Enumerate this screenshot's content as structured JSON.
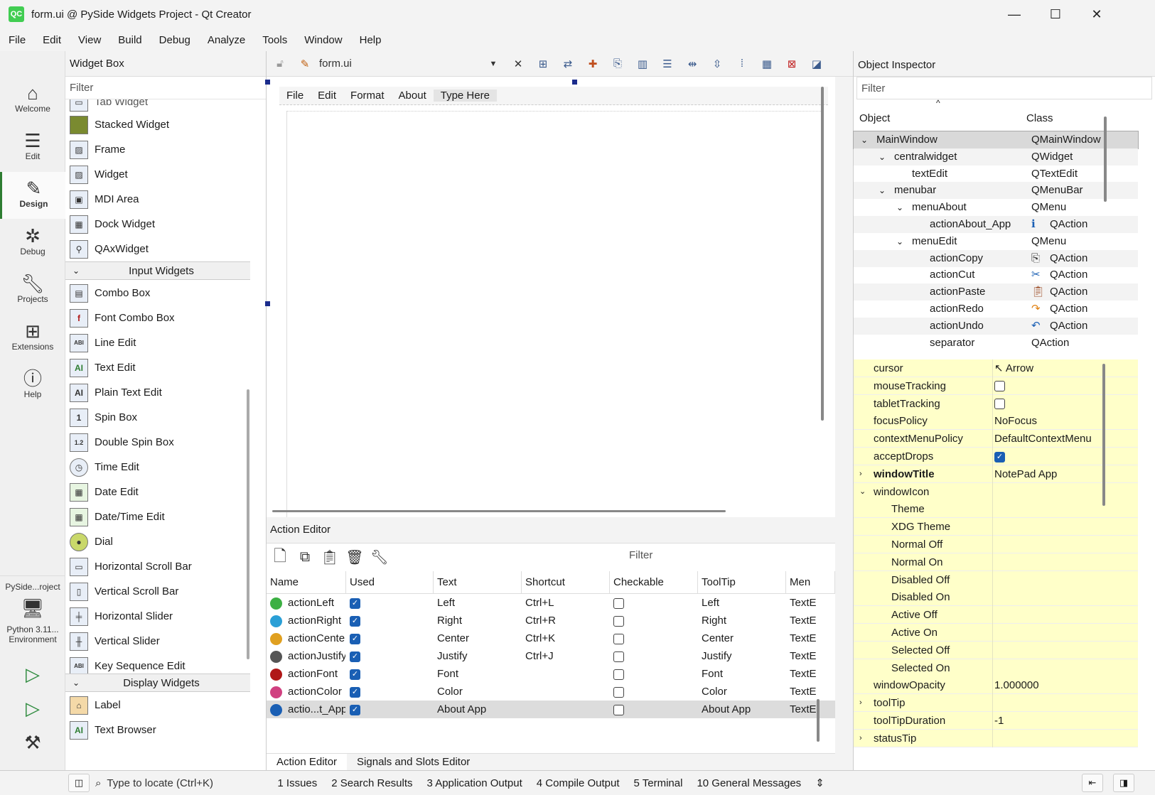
{
  "window": {
    "title": "form.ui @ PySide Widgets Project - Qt Creator",
    "icon_text": "QC"
  },
  "menubar": [
    "File",
    "Edit",
    "View",
    "Build",
    "Debug",
    "Analyze",
    "Tools",
    "Window",
    "Help"
  ],
  "modes": [
    {
      "label": "Welcome",
      "icon": "home-icon"
    },
    {
      "label": "Edit",
      "icon": "edit-icon"
    },
    {
      "label": "Design",
      "icon": "design-icon"
    },
    {
      "label": "Debug",
      "icon": "debug-icon"
    },
    {
      "label": "Projects",
      "icon": "wrench-icon"
    },
    {
      "label": "Extensions",
      "icon": "extensions-icon"
    },
    {
      "label": "Help",
      "icon": "help-icon"
    }
  ],
  "project_selector": {
    "project": "PySide...roject",
    "kit_line1": "Python 3.11...",
    "kit_line2": "Environment"
  },
  "widget_box": {
    "title": "Widget Box",
    "filter_placeholder": "Filter",
    "partial_item": "Tab Widget",
    "containers": [
      "Stacked Widget",
      "Frame",
      "Widget",
      "MDI Area",
      "Dock Widget",
      "QAxWidget"
    ],
    "input_category": "Input Widgets",
    "inputs": [
      "Combo Box",
      "Font Combo Box",
      "Line Edit",
      "Text Edit",
      "Plain Text Edit",
      "Spin Box",
      "Double Spin Box",
      "Time Edit",
      "Date Edit",
      "Date/Time Edit",
      "Dial",
      "Horizontal Scroll Bar",
      "Vertical Scroll Bar",
      "Horizontal Slider",
      "Vertical Slider",
      "Key Sequence Edit"
    ],
    "display_category": "Display Widgets",
    "displays": [
      "Label",
      "Text Browser"
    ]
  },
  "editor": {
    "file": "form.ui",
    "form_menu": [
      "File",
      "Edit",
      "Format",
      "About",
      "Type Here"
    ]
  },
  "action_editor": {
    "title": "Action Editor",
    "filter_placeholder": "Filter",
    "columns": [
      "Name",
      "Used",
      "Text",
      "Shortcut",
      "Checkable",
      "ToolTip",
      "Men"
    ],
    "rows": [
      {
        "name": "actionLeft",
        "used": true,
        "text": "Left",
        "shortcut": "Ctrl+L",
        "checkable": false,
        "tooltip": "Left",
        "menu": "TextE",
        "color": "#3cb043"
      },
      {
        "name": "actionRight",
        "used": true,
        "text": "Right",
        "shortcut": "Ctrl+R",
        "checkable": false,
        "tooltip": "Right",
        "menu": "TextE",
        "color": "#2a9fd6"
      },
      {
        "name": "actionCenter",
        "used": true,
        "text": "Center",
        "shortcut": "Ctrl+K",
        "checkable": false,
        "tooltip": "Center",
        "menu": "TextE",
        "color": "#e0a020"
      },
      {
        "name": "actionJustify",
        "used": true,
        "text": "Justify",
        "shortcut": "Ctrl+J",
        "checkable": false,
        "tooltip": "Justify",
        "menu": "TextE",
        "color": "#555555"
      },
      {
        "name": "actionFont",
        "used": true,
        "text": "Font",
        "shortcut": "",
        "checkable": false,
        "tooltip": "Font",
        "menu": "TextE",
        "color": "#b01818"
      },
      {
        "name": "actionColor",
        "used": true,
        "text": "Color",
        "shortcut": "",
        "checkable": false,
        "tooltip": "Color",
        "menu": "TextE",
        "color": "#d04080"
      },
      {
        "name": "actio...t_App",
        "used": true,
        "text": "About App",
        "shortcut": "",
        "checkable": false,
        "tooltip": "About App",
        "menu": "TextE",
        "color": "#1a5fb4"
      }
    ],
    "tabs": [
      "Action Editor",
      "Signals and Slots Editor"
    ]
  },
  "object_inspector": {
    "title": "Object Inspector",
    "filter_placeholder": "Filter",
    "columns": [
      "Object",
      "Class"
    ],
    "rows": [
      {
        "object": "MainWindow",
        "class": "QMainWindow",
        "depth": 0,
        "expanded": true
      },
      {
        "object": "centralwidget",
        "class": "QWidget",
        "depth": 1,
        "expanded": true
      },
      {
        "object": "textEdit",
        "class": "QTextEdit",
        "depth": 2
      },
      {
        "object": "menubar",
        "class": "QMenuBar",
        "depth": 1,
        "expanded": true
      },
      {
        "object": "menuAbout",
        "class": "QMenu",
        "depth": 2,
        "expanded": true
      },
      {
        "object": "actionAbout_App",
        "class": "QAction",
        "depth": 3,
        "icon": "info-icon"
      },
      {
        "object": "menuEdit",
        "class": "QMenu",
        "depth": 2,
        "expanded": true
      },
      {
        "object": "actionCopy",
        "class": "QAction",
        "depth": 3,
        "icon": "copy-icon"
      },
      {
        "object": "actionCut",
        "class": "QAction",
        "depth": 3,
        "icon": "cut-icon"
      },
      {
        "object": "actionPaste",
        "class": "QAction",
        "depth": 3,
        "icon": "paste-icon"
      },
      {
        "object": "actionRedo",
        "class": "QAction",
        "depth": 3,
        "icon": "redo-icon"
      },
      {
        "object": "actionUndo",
        "class": "QAction",
        "depth": 3,
        "icon": "undo-icon"
      },
      {
        "object": "separator",
        "class": "QAction",
        "depth": 3
      }
    ]
  },
  "property_editor": {
    "rows": [
      {
        "name": "cursor",
        "value": "Arrow",
        "kind": "text"
      },
      {
        "name": "mouseTracking",
        "value": false,
        "kind": "check"
      },
      {
        "name": "tabletTracking",
        "value": false,
        "kind": "check"
      },
      {
        "name": "focusPolicy",
        "value": "NoFocus",
        "kind": "text"
      },
      {
        "name": "contextMenuPolicy",
        "value": "DefaultContextMenu",
        "kind": "text"
      },
      {
        "name": "acceptDrops",
        "value": true,
        "kind": "check"
      },
      {
        "name": "windowTitle",
        "value": "NotePad App",
        "kind": "text",
        "bold": true,
        "expander": "›"
      },
      {
        "name": "windowIcon",
        "value": "",
        "kind": "text",
        "expander": "⌄"
      },
      {
        "name": "Theme",
        "value": "",
        "kind": "sub"
      },
      {
        "name": "XDG Theme",
        "value": "",
        "kind": "sub"
      },
      {
        "name": "Normal Off",
        "value": "",
        "kind": "sub"
      },
      {
        "name": "Normal On",
        "value": "",
        "kind": "sub"
      },
      {
        "name": "Disabled Off",
        "value": "",
        "kind": "sub"
      },
      {
        "name": "Disabled On",
        "value": "",
        "kind": "sub"
      },
      {
        "name": "Active Off",
        "value": "",
        "kind": "sub"
      },
      {
        "name": "Active On",
        "value": "",
        "kind": "sub"
      },
      {
        "name": "Selected Off",
        "value": "",
        "kind": "sub"
      },
      {
        "name": "Selected On",
        "value": "",
        "kind": "sub"
      },
      {
        "name": "windowOpacity",
        "value": "1.000000",
        "kind": "text"
      },
      {
        "name": "toolTip",
        "value": "",
        "kind": "text",
        "expander": "›"
      },
      {
        "name": "toolTipDuration",
        "value": "-1",
        "kind": "text"
      },
      {
        "name": "statusTip",
        "value": "",
        "kind": "text",
        "expander": "›"
      }
    ]
  },
  "statusbar": {
    "locate_placeholder": "Type to locate (Ctrl+K)",
    "panes": [
      "1  Issues",
      "2  Search Results",
      "3  Application Output",
      "4  Compile Output",
      "5  Terminal",
      "10  General Messages"
    ]
  }
}
